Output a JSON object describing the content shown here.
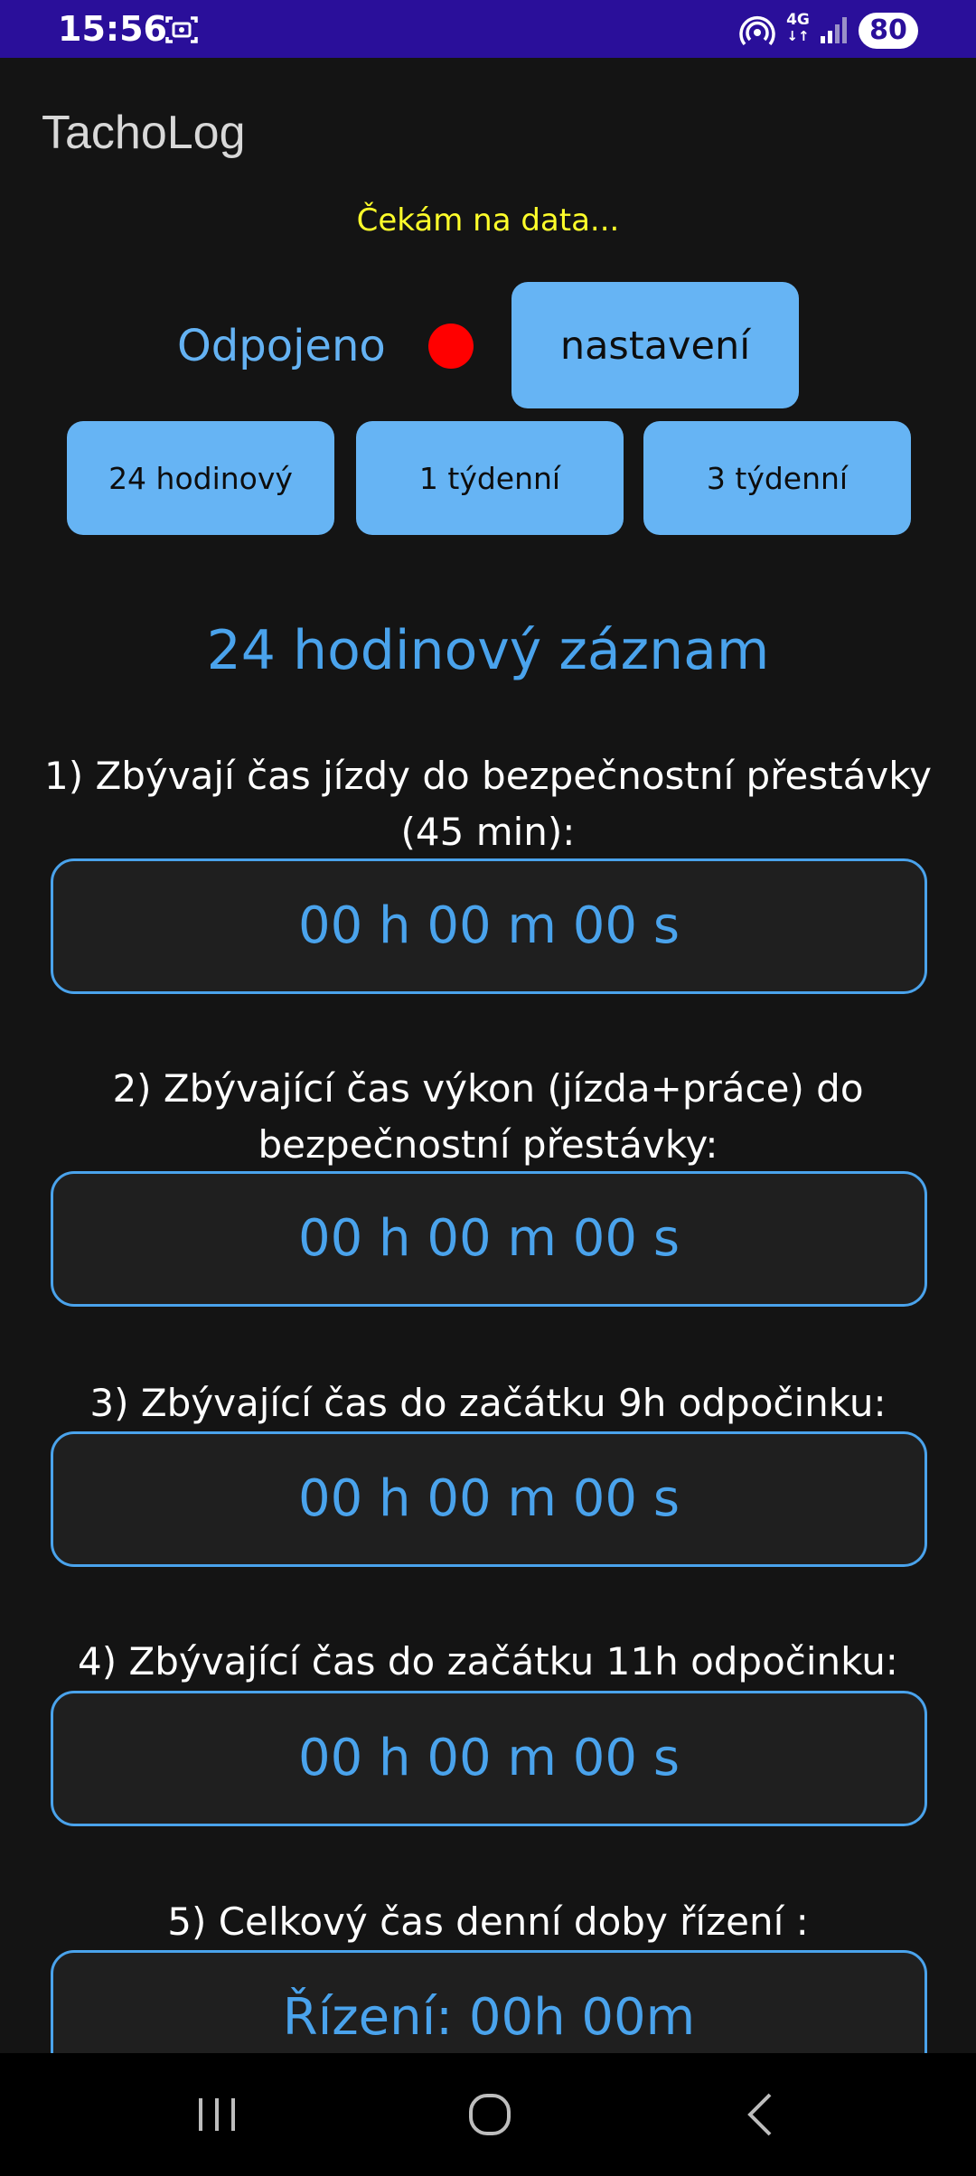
{
  "status_bar": {
    "time": "15:56",
    "network": "4G",
    "network_arrows": "↓↑",
    "battery": "80",
    "icons": [
      "screenshot-icon",
      "hotspot-icon",
      "signal-icon"
    ]
  },
  "app": {
    "title": "TachoLog"
  },
  "waiting_text": "Čekám na data...",
  "connection": {
    "status": "Odpojeno",
    "indicator_color": "#ff0000"
  },
  "buttons": {
    "settings": "nastavení",
    "mode_24h": "24 hodinový",
    "mode_1w": "1 týdenní",
    "mode_3w": "3 týdenní"
  },
  "section_title": "24 hodinový záznam",
  "items": [
    {
      "label": "1) Zbývají čas jízdy do bezpečnostní přestávky (45 min):",
      "value": "00 h 00 m 00 s"
    },
    {
      "label": "2) Zbývající čas výkon (jízda+práce) do bezpečnostní přestávky:",
      "value": "00 h 00 m 00 s"
    },
    {
      "label": "3) Zbývající čas do začátku 9h odpočinku:",
      "value": "00 h 00 m 00 s"
    },
    {
      "label": "4) Zbývající čas do začátku 11h odpočinku:",
      "value": "00 h 00 m 00 s"
    },
    {
      "label": "5) Celkový čas denní doby řízení :",
      "value": "Řízení: 00h 00m"
    }
  ],
  "colors": {
    "status_bar": "#2a0f9a",
    "background": "#141414",
    "accent": "#4aa3ec",
    "button": "#66b4f4",
    "waiting": "#ffff2a"
  },
  "nav_bar": {
    "icons": [
      "recent-apps-icon",
      "home-icon",
      "back-icon"
    ]
  }
}
